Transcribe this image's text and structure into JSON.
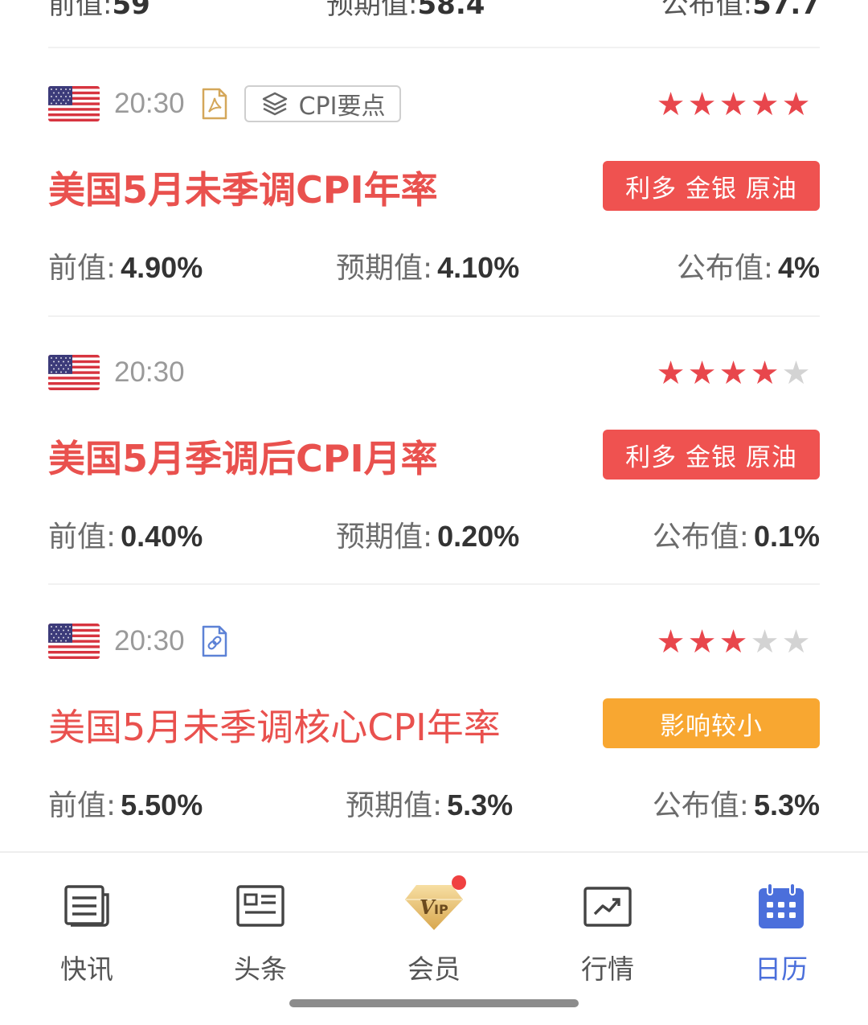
{
  "partial_row": {
    "prev_label": "前值:",
    "prev_value": "59",
    "expected_label": "预期值:",
    "expected_value": "58.4",
    "published_label": "公布值:",
    "published_value": "57.7"
  },
  "events": [
    {
      "time": "20:30",
      "has_pdf_icon": true,
      "chip_label": "CPI要点",
      "rating": 5,
      "title": "美国5月未季调CPI年率",
      "badge": "利多 金银 原油",
      "prev_label": "前值:",
      "prev_value": "4.90%",
      "expected_label": "预期值:",
      "expected_value": "4.10%",
      "published_label": "公布值:",
      "published_value": "4%"
    },
    {
      "time": "20:30",
      "rating": 4,
      "title": "美国5月季调后CPI月率",
      "badge": "利多 金银 原油",
      "prev_label": "前值:",
      "prev_value": "0.40%",
      "expected_label": "预期值:",
      "expected_value": "0.20%",
      "published_label": "公布值:",
      "published_value": "0.1%"
    },
    {
      "time": "20:30",
      "has_link_icon": true,
      "rating": 3,
      "title": "美国5月未季调核心CPI年率",
      "badge": "影响较小",
      "prev_label": "前值:",
      "prev_value": "5.50%",
      "expected_label": "预期值:",
      "expected_value": "5.3%",
      "published_label": "公布值:",
      "published_value": "5.3%"
    }
  ],
  "colors": {
    "accent_red": "#e9514e",
    "badge_red": "#ef5250",
    "badge_orange": "#f8a731",
    "active_tab": "#4b6fdb"
  },
  "tabbar": {
    "tabs": [
      {
        "label": "快讯",
        "icon": "news-flash-icon"
      },
      {
        "label": "头条",
        "icon": "headline-icon"
      },
      {
        "label": "会员",
        "icon": "vip-diamond-icon",
        "notification_dot": true
      },
      {
        "label": "行情",
        "icon": "market-chart-icon"
      },
      {
        "label": "日历",
        "icon": "calendar-icon",
        "active": true
      }
    ]
  }
}
